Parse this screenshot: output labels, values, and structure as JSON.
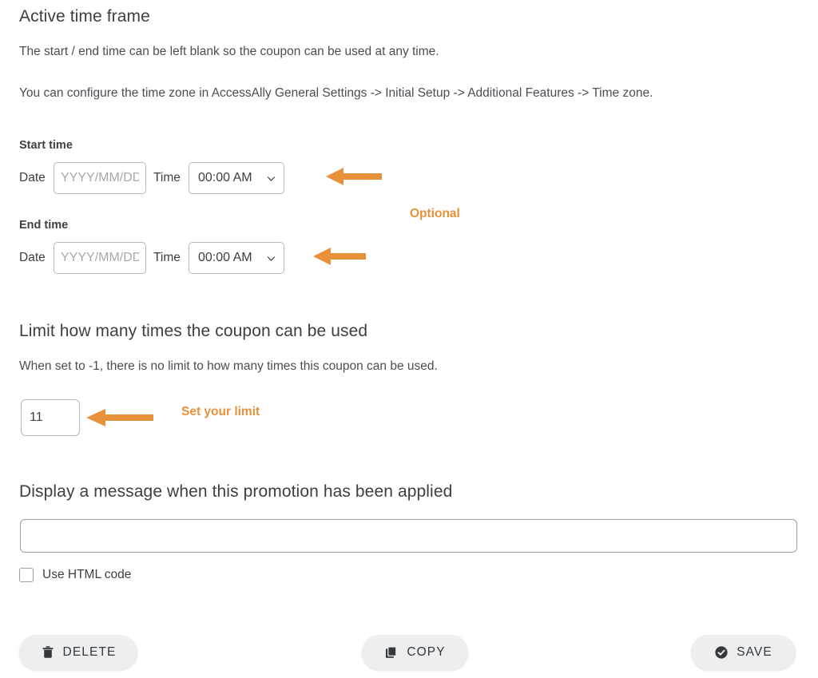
{
  "active_time_frame": {
    "title": "Active time frame",
    "description_1": "The start / end time can be left blank so the coupon can be used at any time.",
    "description_2": "You can configure the time zone in AccessAlly General Settings -> Initial Setup -> Additional Features -> Time zone.",
    "start_time": {
      "label": "Start time",
      "date_label": "Date",
      "date_value": "",
      "date_placeholder": "YYYY/MM/DD",
      "time_label": "Time",
      "time_value": "00:00 AM"
    },
    "end_time": {
      "label": "End time",
      "date_label": "Date",
      "date_value": "",
      "date_placeholder": "YYYY/MM/DD",
      "time_label": "Time",
      "time_value": "00:00 AM"
    },
    "annotation": "Optional"
  },
  "limit": {
    "title": "Limit how many times the coupon can be used",
    "description": "When set to -1, there is no limit to how many times this coupon can be used.",
    "value": "11",
    "annotation": "Set your limit"
  },
  "message": {
    "title": "Display a message when this promotion has been applied",
    "value": "",
    "placeholder": "",
    "use_html_label": "Use HTML code",
    "use_html_checked": false
  },
  "actions": {
    "delete_label": "DELETE",
    "copy_label": "COPY",
    "save_label": "SAVE"
  },
  "colors": {
    "accent_orange": "#e8913a",
    "text": "#3c4043",
    "border": "#b6b8bb",
    "button_bg": "#eceef0"
  }
}
